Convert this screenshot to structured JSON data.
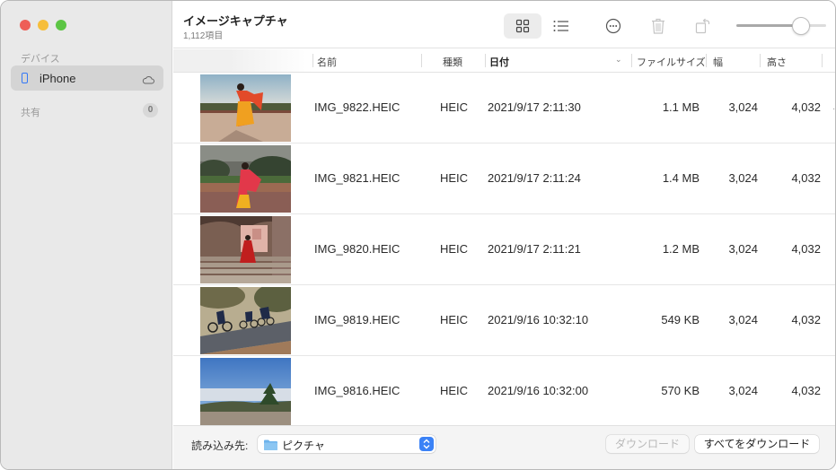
{
  "window": {
    "title": "イメージキャプチャ",
    "item_count": "1,112項目"
  },
  "sidebar": {
    "devices_header": "デバイス",
    "device": {
      "label": "iPhone",
      "icon": "iphone-icon",
      "status_icon": "cloud-icon"
    },
    "shared_header": "共有",
    "shared_count": "0"
  },
  "toolbar": {
    "buttons": [
      {
        "name": "grid-view",
        "icon": "grid-icon",
        "selected": true
      },
      {
        "name": "list-view",
        "icon": "list-icon",
        "selected": false
      },
      {
        "name": "more",
        "icon": "ellipsis-circle-icon"
      },
      {
        "name": "delete",
        "icon": "trash-icon",
        "enabled": false
      },
      {
        "name": "rotate",
        "icon": "rotate-icon",
        "enabled": false
      }
    ],
    "thumbnail_size_fraction": 0.72
  },
  "table": {
    "columns": {
      "name": "名前",
      "kind": "種類",
      "date": "日付",
      "size": "ファイルサイズ",
      "width": "幅",
      "height": "高さ"
    },
    "sorted_by": "日付",
    "rows": [
      {
        "name": "IMG_9822.HEIC",
        "kind": "HEIC",
        "date": "2021/9/17 2:11:30",
        "size": "1.1 MB",
        "width": "3,024",
        "height": "4,032",
        "thumb": "dancer-terrace"
      },
      {
        "name": "IMG_9821.HEIC",
        "kind": "HEIC",
        "date": "2021/9/17 2:11:24",
        "size": "1.4 MB",
        "width": "3,024",
        "height": "4,032",
        "thumb": "dancer-garden"
      },
      {
        "name": "IMG_9820.HEIC",
        "kind": "HEIC",
        "date": "2021/9/17 2:11:21",
        "size": "1.2 MB",
        "width": "3,024",
        "height": "4,032",
        "thumb": "stairs-archway"
      },
      {
        "name": "IMG_9819.HEIC",
        "kind": "HEIC",
        "date": "2021/9/16 10:32:10",
        "size": "549 KB",
        "width": "3,024",
        "height": "4,032",
        "thumb": "cyclists"
      },
      {
        "name": "IMG_9816.HEIC",
        "kind": "HEIC",
        "date": "2021/9/16 10:32:00",
        "size": "570 KB",
        "width": "3,024",
        "height": "4,032",
        "thumb": "mountain-sky"
      }
    ]
  },
  "footer": {
    "import_to_label": "読み込み先:",
    "import_to_value": "ピクチャ",
    "download_label": "ダウンロード",
    "download_all_label": "すべてをダウンロード"
  }
}
